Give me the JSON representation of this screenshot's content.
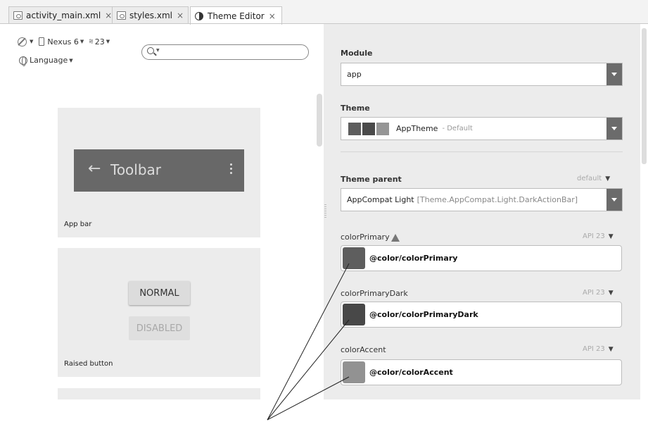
{
  "tabs": [
    {
      "label": "activity_main.xml",
      "close": "×"
    },
    {
      "label": "styles.xml",
      "close": "×"
    },
    {
      "label": "Theme Editor",
      "close": "×"
    }
  ],
  "toolbar": {
    "device": "Nexus 6",
    "api": "23",
    "language": "Language",
    "search": {
      "value": "",
      "placeholder": ""
    }
  },
  "preview": {
    "app_bar": {
      "title": "Toolbar",
      "back_icon": "←",
      "label": "App bar"
    },
    "raised_button": {
      "normal": "NORMAL",
      "disabled": "DISABLED",
      "label": "Raised button"
    }
  },
  "panel": {
    "module_label": "Module",
    "module_value": "app",
    "theme_label": "Theme",
    "theme_name": "AppTheme",
    "theme_suffix": "- Default",
    "theme_swatches": [
      "#5d5d5d",
      "#4a4a4a",
      "#959595"
    ],
    "parent_label": "Theme parent",
    "parent_tag": "default",
    "parent_name": "AppCompat Light",
    "parent_detail": "[Theme.AppCompat.Light.DarkActionBar]",
    "attributes": [
      {
        "name": "colorPrimary",
        "api": "API 23",
        "value": "@color/colorPrimary",
        "color": "#5e5e5e",
        "warning": true
      },
      {
        "name": "colorPrimaryDark",
        "api": "API 23",
        "value": "@color/colorPrimaryDark",
        "color": "#484848",
        "warning": false
      },
      {
        "name": "colorAccent",
        "api": "API 23",
        "value": "@color/colorAccent",
        "color": "#929292",
        "warning": false
      }
    ]
  }
}
